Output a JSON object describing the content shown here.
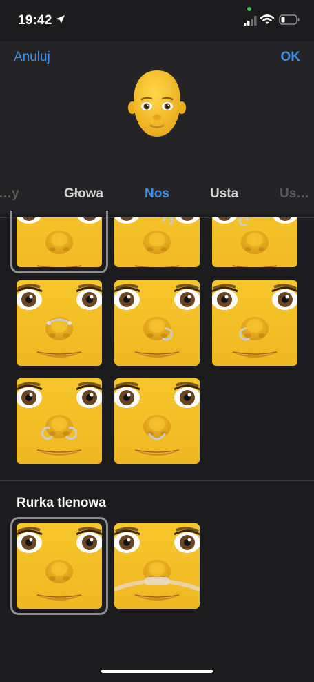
{
  "status_bar": {
    "time": "19:42"
  },
  "nav": {
    "cancel_label": "Anuluj",
    "ok_label": "OK"
  },
  "tabs": [
    {
      "label": "…y"
    },
    {
      "label": "Głowa"
    },
    {
      "label": "Nos"
    },
    {
      "label": "Usta"
    },
    {
      "label": "Us…"
    }
  ],
  "selected_tab": "Nos",
  "piercing_options": [
    {
      "name": "no-piercing",
      "selected": true
    },
    {
      "name": "right-nostril-ring-top"
    },
    {
      "name": "left-nostril-ring-top"
    },
    {
      "name": "septum-ring"
    },
    {
      "name": "right-nostril-hoop"
    },
    {
      "name": "left-nostril-hoop"
    },
    {
      "name": "double-nostril-rings"
    },
    {
      "name": "septum-hoop"
    }
  ],
  "oxygen_section": {
    "title": "Rurka tlenowa",
    "options": [
      {
        "name": "no-oxygen-tube",
        "selected": true
      },
      {
        "name": "oxygen-tube"
      }
    ]
  },
  "colors": {
    "accent": "#3a91ea",
    "background": "#1c1c1e",
    "skin": "#f3c229"
  }
}
